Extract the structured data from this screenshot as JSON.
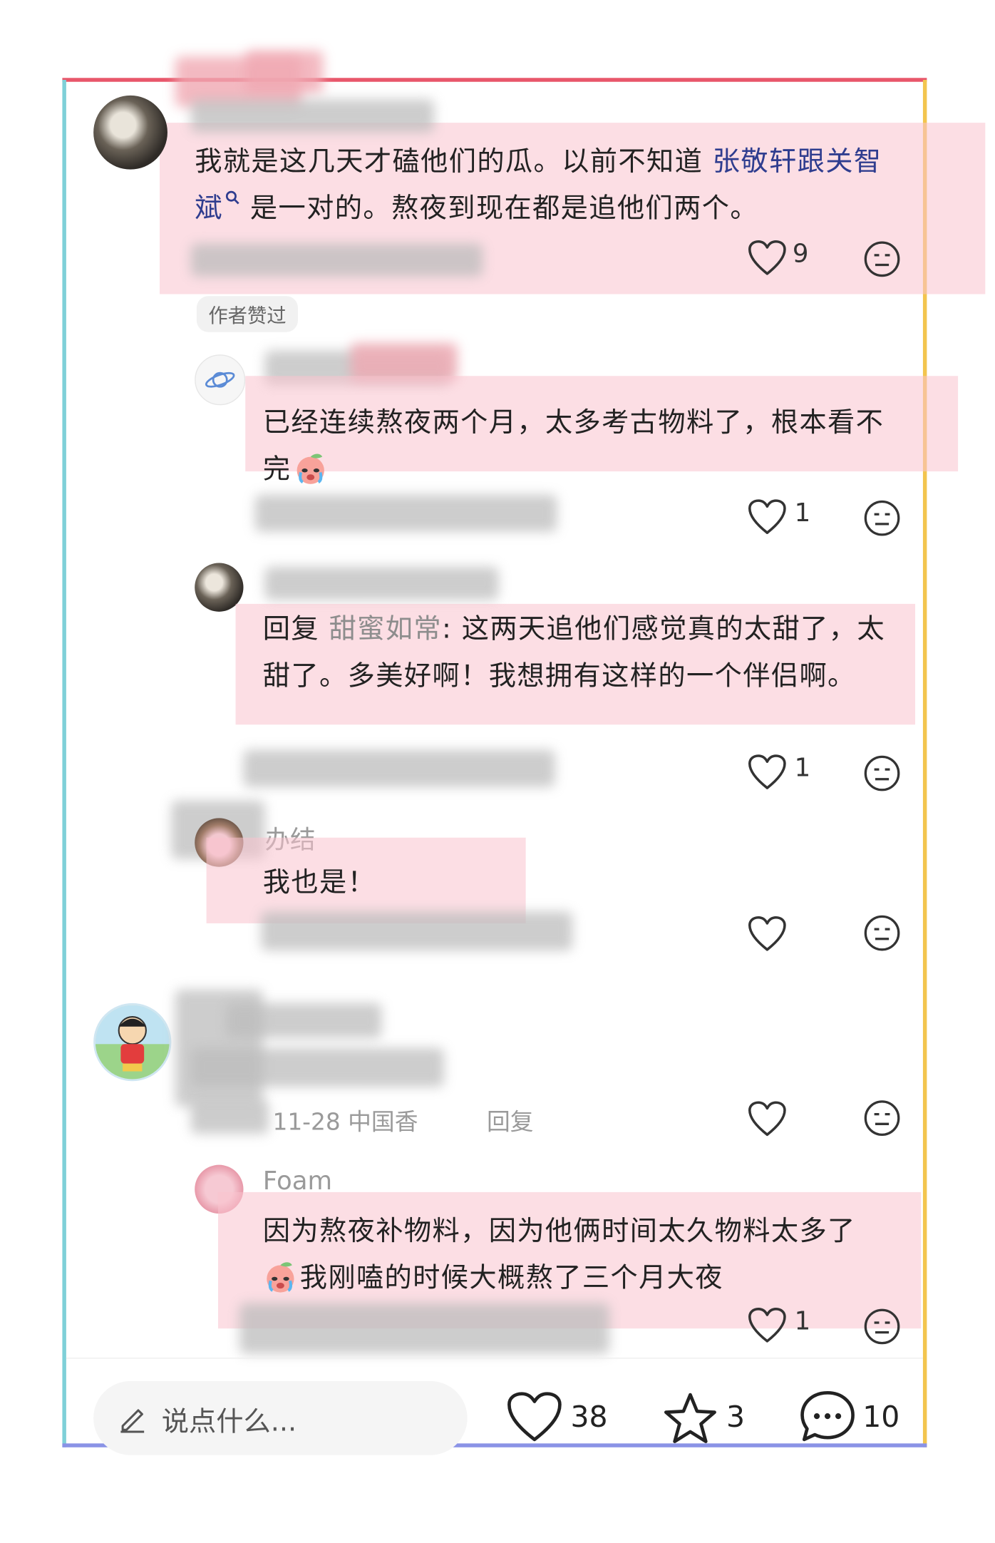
{
  "colors": {
    "frame_top": "#e8566a",
    "frame_left": "#7fd0d8",
    "frame_right": "#f3c54e",
    "frame_bottom": "#8a93e6",
    "highlight": "#fac3cd",
    "link": "#2f3d8f"
  },
  "comments": [
    {
      "text_part1": "我就是这几天才磕他们的瓜。以前不知道 ",
      "link_text": "张敬轩跟关智斌",
      "text_part2": " 是一对的。熬夜到现在都是追他们两个。",
      "likes": "9",
      "badge": "作者赞过",
      "icons": [
        "search-icon",
        "heart-icon",
        "emoji-icon"
      ]
    },
    {
      "text": "已经连续熬夜两个月，太多考古物料了，根本看不完",
      "emoji": "crying-peach-emoji",
      "likes": "1"
    },
    {
      "reply_label": "回复 ",
      "reply_to": "甜蜜如常",
      "text": ": 这两天追他们感觉真的太甜了，太甜了。多美好啊！我想拥有这样的一个伴侣啊。",
      "likes": "1"
    },
    {
      "name": "办结",
      "text": "我也是！"
    },
    {
      "date": "11-28 中国香",
      "reply": "回复"
    },
    {
      "name": "Foam",
      "text_part1": "因为熬夜补物料，因为他俩时间太久物料太多了",
      "text_part2": "我刚嗑的时候大概熬了三个月大夜",
      "likes": "1"
    }
  ],
  "bottom_bar": {
    "placeholder": "说点什么...",
    "likes": "38",
    "stars": "3",
    "comments": "10",
    "icons": [
      "pencil-icon",
      "heart-icon",
      "star-icon",
      "comment-icon"
    ]
  }
}
